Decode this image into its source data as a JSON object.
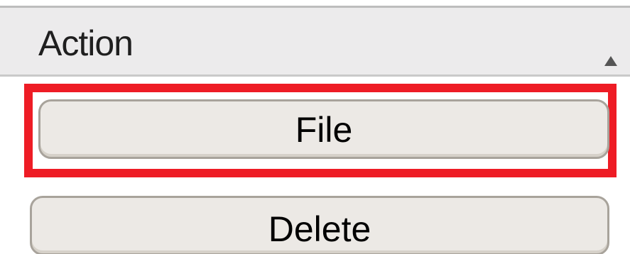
{
  "header": {
    "column_label": "Action",
    "sort_indicator": "sort-ascending-icon"
  },
  "actions": {
    "file_label": "File",
    "delete_label": "Delete"
  },
  "colors": {
    "highlight": "#ee1c25",
    "button_bg": "#ece9e5",
    "header_bg": "#ecebec"
  }
}
